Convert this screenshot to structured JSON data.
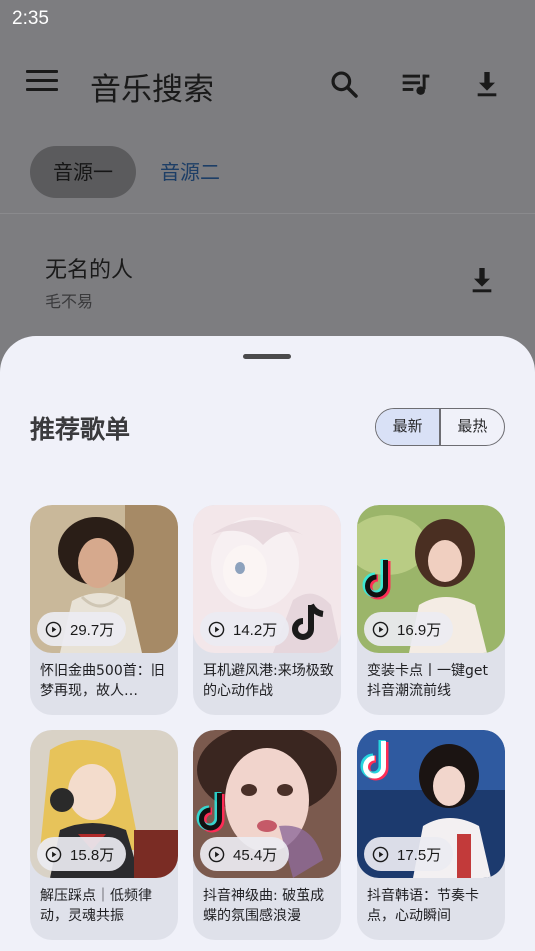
{
  "status_bar": {
    "time": "2:35"
  },
  "toolbar": {
    "title": "音乐搜索"
  },
  "tabs": [
    {
      "label": "音源一",
      "active": true
    },
    {
      "label": "音源二",
      "active": false
    }
  ],
  "results": [
    {
      "title": "无名的人",
      "artist": "毛不易"
    }
  ],
  "sheet": {
    "title": "推荐歌单",
    "sort": {
      "options": [
        "最新",
        "最热"
      ],
      "selected": "最新"
    },
    "playlists": [
      {
        "plays": "29.7万",
        "title": "怀旧金曲500首：旧梦再现，故人…"
      },
      {
        "plays": "14.2万",
        "title": "耳机避风港:来场极致的心动作战"
      },
      {
        "plays": "16.9万",
        "title": "变装卡点丨一键get抖音潮流前线"
      },
      {
        "plays": "15.8万",
        "title": "解压踩点｜低频律动，灵魂共振"
      },
      {
        "plays": "45.4万",
        "title": "抖音神级曲: 破茧成蝶的氛围感浪漫"
      },
      {
        "plays": "17.5万",
        "title": "抖音韩语：节奏卡点，心动瞬间"
      }
    ]
  },
  "colors": {
    "sheet_bg": "#f0f1f9",
    "scrim": "#7d7d80",
    "accent_tab": "#1d3e66",
    "selected_segment": "#d9e1f6"
  }
}
